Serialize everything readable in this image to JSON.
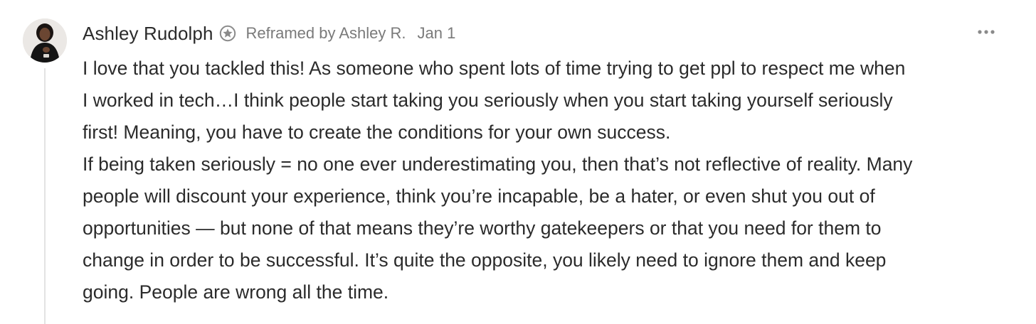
{
  "comment": {
    "author": "Ashley Rudolph",
    "reframed_by": "Reframed by Ashley R.",
    "date": "Jan 1",
    "avatar_icon": "avatar",
    "badge_icon": "star-badge-icon",
    "more_icon": "more-options-icon",
    "paragraphs": [
      {
        "lines": [
          "I love that you tackled this! As someone who spent lots of time trying to get ppl to respect me when",
          "I worked in tech…I think people start taking you seriously when you start taking yourself seriously",
          "first! Meaning, you have to create the conditions for your own success."
        ]
      },
      {
        "lines": [
          "If being taken seriously = no one ever underestimating you, then that’s not reflective of reality. Many",
          "people will discount your experience, think you’re incapable, be a hater, or even shut you out of",
          "opportunities — but none of that means they’re worthy gatekeepers or that you need for them to",
          "change in order to be successful. It’s quite the opposite, you likely need to ignore them and keep",
          "going. People are wrong all the time."
        ]
      }
    ]
  }
}
